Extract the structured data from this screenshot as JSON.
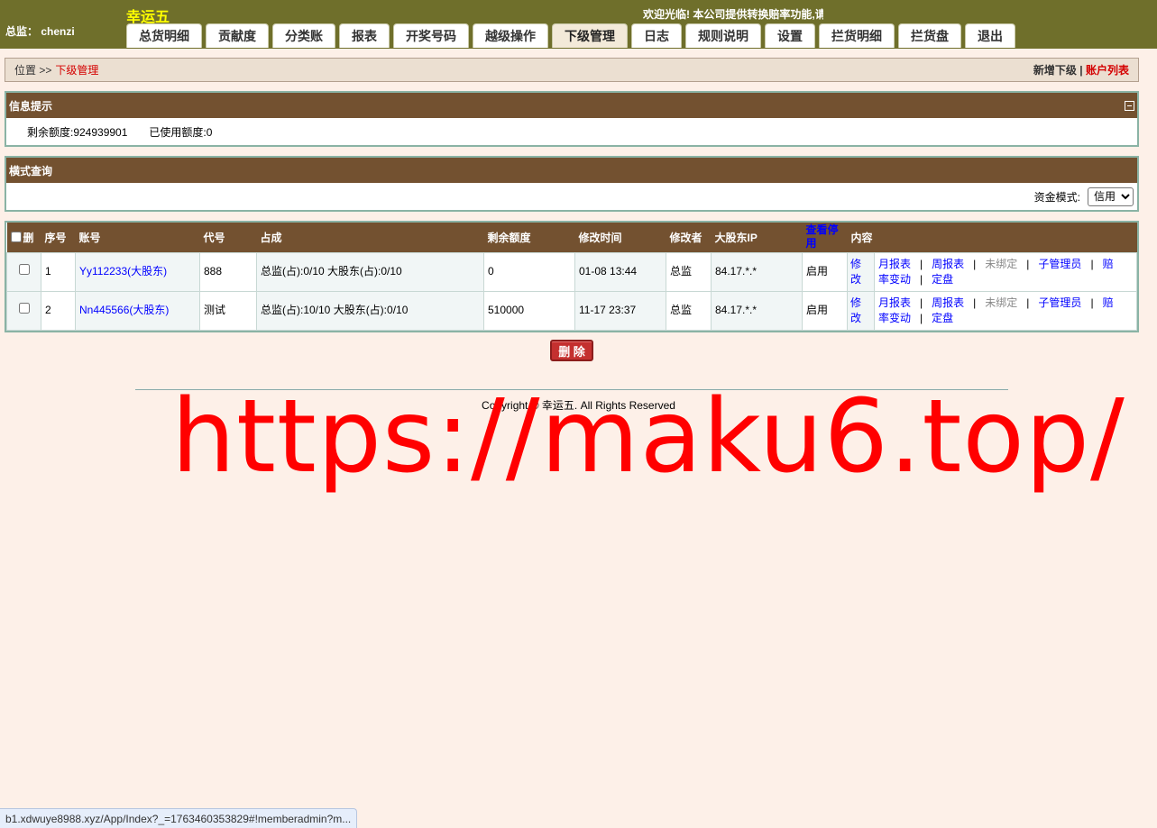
{
  "header": {
    "user_label": "总监： chenzi",
    "brand": "幸运五",
    "marquee": "欢迎光临! 本公司提供转换赔率功能,请"
  },
  "nav": {
    "tabs": [
      {
        "label": "总货明细",
        "active": false
      },
      {
        "label": "贡献度",
        "active": false
      },
      {
        "label": "分类账",
        "active": false
      },
      {
        "label": "报表",
        "active": false
      },
      {
        "label": "开奖号码",
        "active": false
      },
      {
        "label": "越级操作",
        "active": false
      },
      {
        "label": "下级管理",
        "active": true
      },
      {
        "label": "日志",
        "active": false
      },
      {
        "label": "规则说明",
        "active": false
      },
      {
        "label": "设置",
        "active": false
      },
      {
        "label": "拦货明细",
        "active": false
      },
      {
        "label": "拦货盘",
        "active": false
      },
      {
        "label": "退出",
        "active": false
      }
    ]
  },
  "breadcrumb": {
    "position": "位置 >>",
    "current": "下级管理",
    "add_sub": "新增下级",
    "divider": "|",
    "account_list": "账户列表"
  },
  "info_panel": {
    "title": "信息提示",
    "remaining": "剩余额度:924939901",
    "used": "已使用额度:0"
  },
  "search_panel": {
    "title": "横式查询",
    "fund_mode_label": "资金模式:",
    "fund_mode_value": "信用"
  },
  "table": {
    "headers": {
      "delete": "删",
      "index": "序号",
      "account": "账号",
      "code": "代号",
      "share": "占成",
      "remaining": "剩余额度",
      "modified_time": "修改时间",
      "modifier": "修改者",
      "ip": "大股东IP",
      "view_stop": "查看停用",
      "content": "内容"
    },
    "rows": [
      {
        "index": "1",
        "account": "Yy112233(大股东)",
        "code": "888",
        "share": "总监(占):0/10 大股东(占):0/10",
        "remaining": "0",
        "modified_time": "01-08 13:44",
        "modifier": "总监",
        "ip": "84.17.*.*",
        "status": "启用",
        "edit": "修改",
        "links": {
          "monthly": "月报表",
          "weekly": "周报表",
          "unbound": "未绑定",
          "sub_admin": "子管理员",
          "odds_change": "赔率变动",
          "fixed_plate": "定盘"
        }
      },
      {
        "index": "2",
        "account": "Nn445566(大股东)",
        "code": "测试",
        "share": "总监(占):10/10 大股东(占):0/10",
        "remaining": "510000",
        "modified_time": "11-17 23:37",
        "modifier": "总监",
        "ip": "84.17.*.*",
        "status": "启用",
        "edit": "修改",
        "links": {
          "monthly": "月报表",
          "weekly": "周报表",
          "unbound": "未绑定",
          "sub_admin": "子管理员",
          "odds_change": "赔率变动",
          "fixed_plate": "定盘"
        }
      }
    ]
  },
  "delete_button": "删 除",
  "footer": {
    "copyright": "Copyright © 幸运五. All Rights Reserved"
  },
  "watermark": "https://maku6.top/",
  "statusbar": "b1.xdwuye8988.xyz/App/Index?_=1763460353829#!memberadmin?m...",
  "colors": {
    "topbar": "#6f6f2b",
    "panel_head": "#735130",
    "page_bg": "#fdf0e8",
    "accent_red": "#d40000",
    "link_blue": "#0000ff",
    "brand_yellow": "#ffff00"
  }
}
